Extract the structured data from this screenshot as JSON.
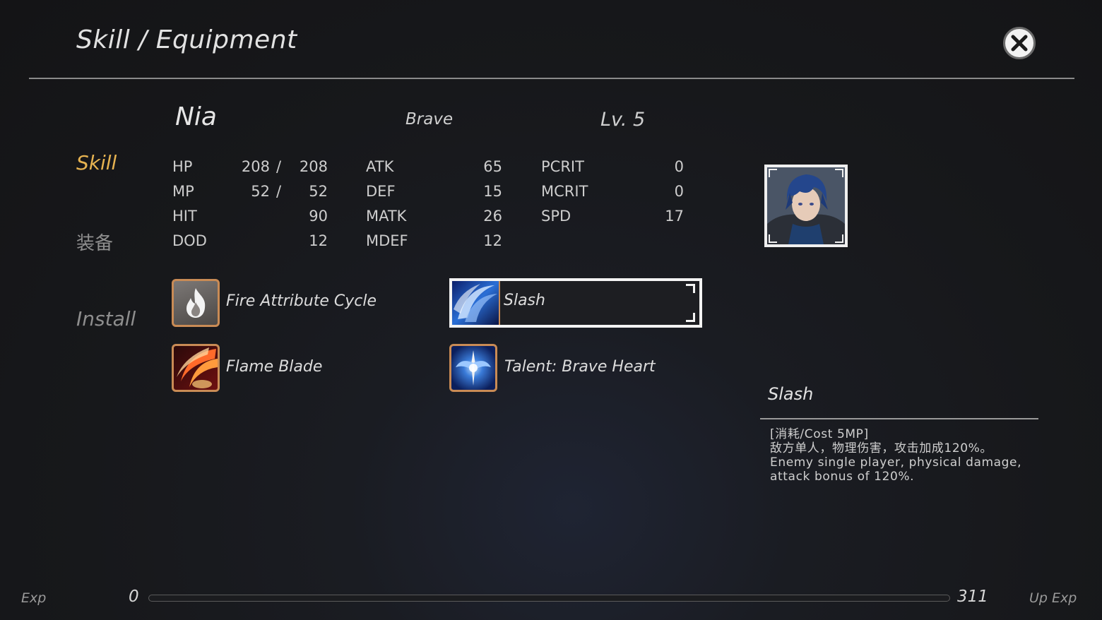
{
  "header": {
    "title": "Skill / Equipment",
    "close_icon": "close-icon"
  },
  "character": {
    "name": "Nia",
    "class": "Brave",
    "level": "Lv. 5"
  },
  "menu": {
    "skill": "Skill",
    "equipment": "装备",
    "install": "Install"
  },
  "stats": {
    "hp": {
      "label": "HP",
      "current": "208",
      "sep": "/",
      "max": "208"
    },
    "mp": {
      "label": "MP",
      "current": "52",
      "sep": "/",
      "max": "52"
    },
    "hit": {
      "label": "HIT",
      "value": "90"
    },
    "dod": {
      "label": "DOD",
      "value": "12"
    },
    "atk": {
      "label": "ATK",
      "value": "65"
    },
    "def": {
      "label": "DEF",
      "value": "15"
    },
    "matk": {
      "label": "MATK",
      "value": "26"
    },
    "mdef": {
      "label": "MDEF",
      "value": "12"
    },
    "pcrit": {
      "label": "PCRIT",
      "value": "0"
    },
    "mcrit": {
      "label": "MCRIT",
      "value": "0"
    },
    "spd": {
      "label": "SPD",
      "value": "17"
    }
  },
  "skills": [
    {
      "label": "Fire Attribute Cycle",
      "icon": "fire-icon"
    },
    {
      "label": "Slash",
      "icon": "slash-swirl-icon",
      "selected": true
    },
    {
      "label": "Flame Blade",
      "icon": "flame-blade-icon"
    },
    {
      "label": "Talent: Brave Heart",
      "icon": "brave-heart-icon"
    }
  ],
  "detail": {
    "title": "Slash",
    "lines": [
      "[消耗/Cost 5MP]",
      "敌方单人，物理伤害，攻击加成120%。",
      "Enemy single player, physical damage,",
      "attack bonus of 120%."
    ]
  },
  "exp": {
    "label": "Exp",
    "current": "0",
    "required": "311",
    "up_label": "Up Exp",
    "progress": 0
  },
  "colors": {
    "accent": "#e7b351",
    "background": "#17181b",
    "icon_border": "#c98b55"
  }
}
